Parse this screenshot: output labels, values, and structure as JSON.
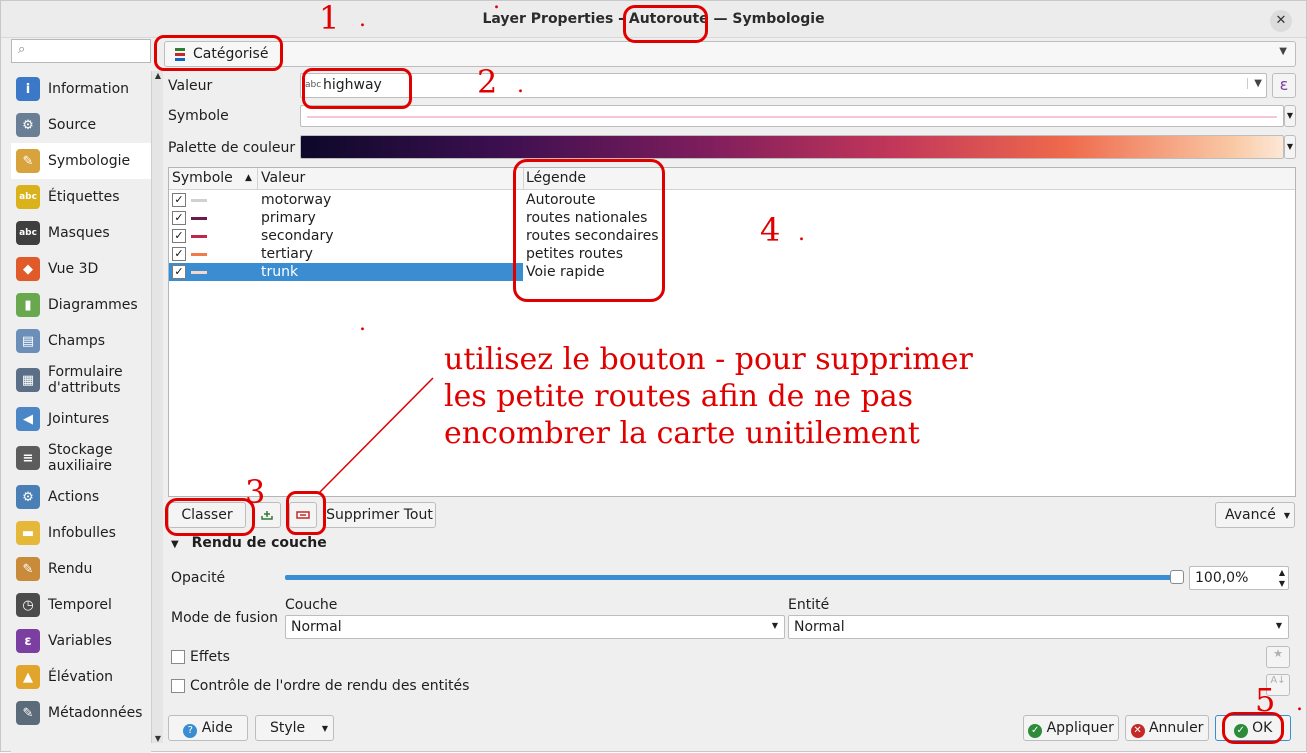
{
  "window": {
    "title": "Layer Properties - Autoroute — Symbologie",
    "close_glyph": "✕"
  },
  "sidebar": {
    "search_placeholder": "",
    "items": [
      {
        "label": "Information",
        "icon": "info-icon",
        "color": "#3c78c8"
      },
      {
        "label": "Source",
        "icon": "source-icon",
        "color": "#6a7f96"
      },
      {
        "label": "Symbologie",
        "icon": "paintbrush-icon",
        "color": "#d8a23c"
      },
      {
        "label": "Étiquettes",
        "icon": "labels-abc-icon",
        "color": "#d9b21c"
      },
      {
        "label": "Masques",
        "icon": "masks-abc-icon",
        "color": "#3f3f3f"
      },
      {
        "label": "Vue 3D",
        "icon": "cube-3d-icon",
        "color": "#e05a2a"
      },
      {
        "label": "Diagrammes",
        "icon": "diagram-icon",
        "color": "#6aa84f"
      },
      {
        "label": "Champs",
        "icon": "fields-icon",
        "color": "#6b8fb8"
      },
      {
        "label": "Formulaire d'attributs",
        "icon": "form-icon",
        "color": "#5b6f86"
      },
      {
        "label": "Jointures",
        "icon": "join-icon",
        "color": "#4b86c6"
      },
      {
        "label": "Stockage auxiliaire",
        "icon": "database-icon",
        "color": "#5c5c5c"
      },
      {
        "label": "Actions",
        "icon": "actions-gear-icon",
        "color": "#4a7fb5"
      },
      {
        "label": "Infobulles",
        "icon": "tooltip-bubble-icon",
        "color": "#e6b83a"
      },
      {
        "label": "Rendu",
        "icon": "rendering-brush-icon",
        "color": "#c98b3a"
      },
      {
        "label": "Temporel",
        "icon": "clock-icon",
        "color": "#4c4c4c"
      },
      {
        "label": "Variables",
        "icon": "epsilon-icon",
        "color": "#7a3fa0"
      },
      {
        "label": "Élévation",
        "icon": "elevation-icon",
        "color": "#e0a52a"
      },
      {
        "label": "Métadonnées",
        "icon": "metadata-icon",
        "color": "#5c6b7a"
      }
    ]
  },
  "renderer": {
    "selected": "Catégorisé"
  },
  "form": {
    "valeur_label": "Valeur",
    "valeur_value": "highway",
    "valeur_type_badge": "abc",
    "expression_glyph": "ε",
    "symbole_label": "Symbole",
    "palette_label": "Palette de couleur"
  },
  "table": {
    "headers": {
      "symbole": "Symbole",
      "valeur": "Valeur",
      "legende": "Légende"
    },
    "rows": [
      {
        "valeur": "motorway",
        "legende": "Autoroute",
        "color": "#d0d0d0",
        "checked": true,
        "selected": false
      },
      {
        "valeur": "primary",
        "legende": "routes nationales",
        "color": "#6a1b4d",
        "checked": true,
        "selected": false
      },
      {
        "valeur": "secondary",
        "legende": "routes secondaires",
        "color": "#c0284a",
        "checked": true,
        "selected": false
      },
      {
        "valeur": "tertiary",
        "legende": "petites routes",
        "color": "#f07a4a",
        "checked": true,
        "selected": false
      },
      {
        "valeur": "trunk",
        "legende": "Voie rapide",
        "color": "#f5d6c8",
        "checked": true,
        "selected": true
      }
    ],
    "check_glyph": "✓"
  },
  "buttons": {
    "classer": "Classer",
    "supprimer_tout": "Supprimer Tout",
    "avance": "Avancé",
    "aide": "Aide",
    "style": "Style",
    "appliquer": "Appliquer",
    "annuler": "Annuler",
    "ok": "OK"
  },
  "layer_rendering": {
    "section_title": "Rendu de couche",
    "opacite_label": "Opacité",
    "opacite_value": "100,0%",
    "opacity_fraction": 1.0,
    "fusion_label": "Mode de fusion",
    "couche_label": "Couche",
    "couche_value": "Normal",
    "entite_label": "Entité",
    "entite_value": "Normal",
    "effets_label": "Effets",
    "ordre_label": "Contrôle de l'ordre de rendu des entités"
  },
  "annotations": {
    "n1": "1",
    "n2": "2",
    "n3": "3",
    "n4": "4",
    "n5": "5",
    "dot": ".",
    "text_line1": "utilisez le bouton - pour supprimer",
    "text_line2": "les petite routes afin de ne pas",
    "text_line3": "encombrer la carte unitilement"
  },
  "colors": {
    "accent": "#3a8dd0",
    "annotation": "#e00000"
  }
}
